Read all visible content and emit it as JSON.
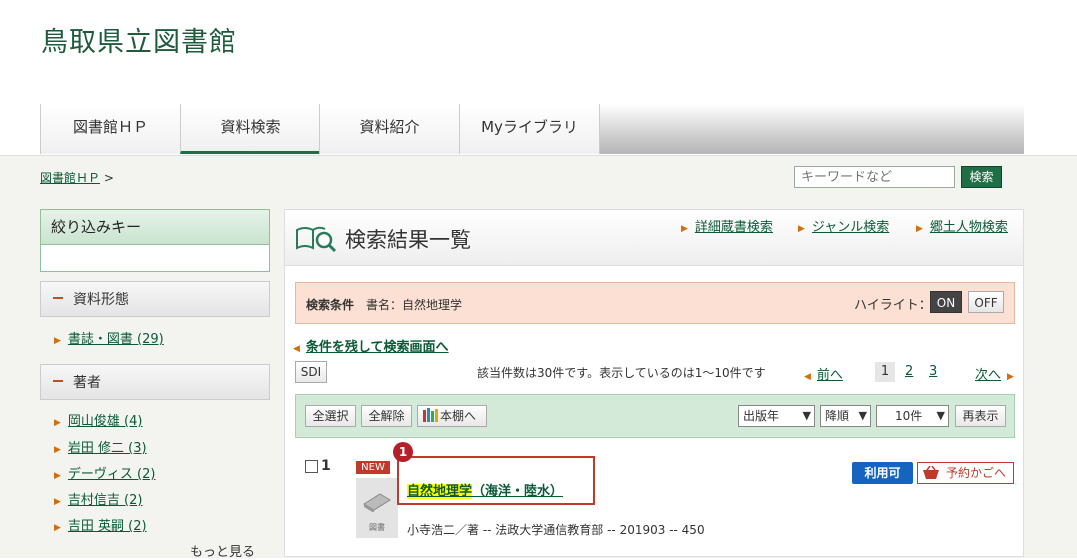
{
  "header": {
    "site_title": "鳥取県立図書館",
    "tabs": [
      {
        "label": "図書館ＨＰ"
      },
      {
        "label": "資料検索"
      },
      {
        "label": "資料紹介"
      },
      {
        "label": "Myライブラリ"
      }
    ]
  },
  "breadcrumb": {
    "link": "図書館ＨＰ",
    "sep": ">"
  },
  "search": {
    "placeholder": "キーワードなど",
    "button": "検索"
  },
  "sidebar": {
    "filter_title": "絞り込みキー",
    "sections": [
      {
        "title": "資料形態",
        "items": [
          "書誌・図書 (29)"
        ]
      },
      {
        "title": "著者",
        "items": [
          "岡山俊雄 (4)",
          "岩田 修二 (3)",
          "デーヴィス (2)",
          "吉村信吉 (2)",
          "吉田 英嗣 (2)"
        ]
      }
    ],
    "more": "もっと見る"
  },
  "main": {
    "title": "検索結果一覧",
    "top_links": [
      "詳細蔵書検索",
      "ジャンル検索",
      "郷土人物検索"
    ],
    "condition": {
      "label": "検索条件",
      "text": "書名：自然地理学",
      "highlight_label": "ハイライト：",
      "on": "ON",
      "off": "OFF"
    },
    "back_link": "条件を残して検索画面へ",
    "sdi": "SDI",
    "count_text": "該当件数は30件です。表示しているのは1～10件です",
    "pager": {
      "prev": "前へ",
      "pages": [
        "1",
        "2",
        "3"
      ],
      "next": "次へ"
    },
    "toolbar": {
      "select_all": "全選択",
      "clear_all": "全解除",
      "shelf": "本棚へ",
      "sort_field": "出版年",
      "sort_order": "降順",
      "per_page": "10件",
      "redisplay": "再表示"
    },
    "results": [
      {
        "num": "1",
        "badge": "NEW",
        "type_label": "図書",
        "title_highlight": "自然地理学",
        "title_rest": "（海洋・陸水）",
        "meta": "小寺浩二／著 -- 法政大学通信教育部 -- 201903 -- 450",
        "status": "利用可",
        "reserve": "予約かごへ",
        "marker": "1"
      }
    ]
  },
  "colors": {
    "brand": "#1e6e46",
    "accent": "#d06f0b",
    "badge_red": "#c0392b"
  }
}
